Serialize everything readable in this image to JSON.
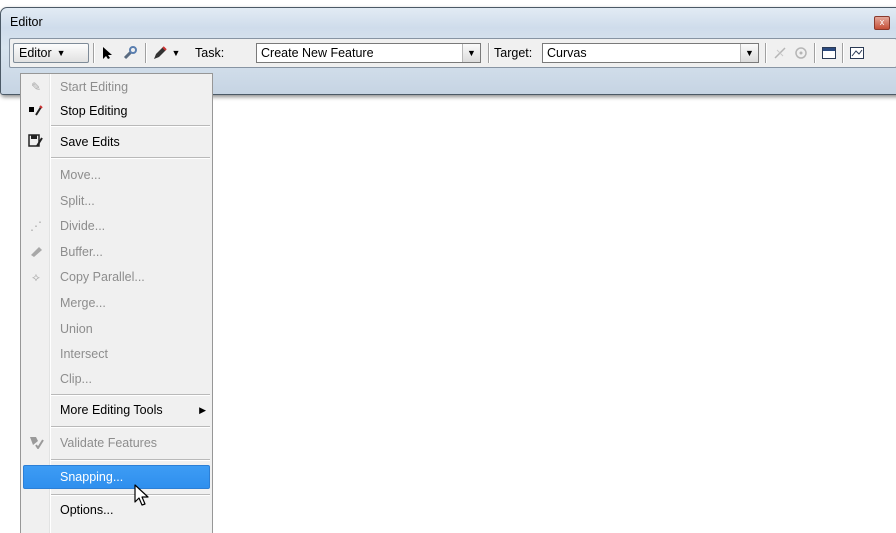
{
  "window": {
    "title": "Editor",
    "close_glyph": "x"
  },
  "toolbar": {
    "editor_menu_label": "Editor",
    "task_label": "Task:",
    "task_value": "Create New Feature",
    "target_label": "Target:",
    "target_value": "Curvas"
  },
  "menu": {
    "items": [
      {
        "label": "Start Editing",
        "icon": "start-editing-icon",
        "enabled": false
      },
      {
        "label": "Stop Editing",
        "icon": "stop-editing-icon",
        "enabled": true
      },
      {
        "label": "Save Edits",
        "icon": "save-edits-icon",
        "enabled": true
      },
      {
        "label": "Move...",
        "enabled": false
      },
      {
        "label": "Split...",
        "enabled": false
      },
      {
        "label": "Divide...",
        "icon": "divide-icon",
        "enabled": false
      },
      {
        "label": "Buffer...",
        "icon": "buffer-icon",
        "enabled": false
      },
      {
        "label": "Copy Parallel...",
        "icon": "copy-parallel-icon",
        "enabled": false
      },
      {
        "label": "Merge...",
        "enabled": false
      },
      {
        "label": "Union",
        "enabled": false
      },
      {
        "label": "Intersect",
        "enabled": false
      },
      {
        "label": "Clip...",
        "enabled": false
      },
      {
        "label": "More Editing Tools",
        "enabled": true,
        "submenu": true
      },
      {
        "label": "Validate Features",
        "icon": "validate-features-icon",
        "enabled": false
      },
      {
        "label": "Snapping...",
        "enabled": true,
        "highlighted": true
      },
      {
        "label": "Options...",
        "enabled": true
      }
    ]
  }
}
